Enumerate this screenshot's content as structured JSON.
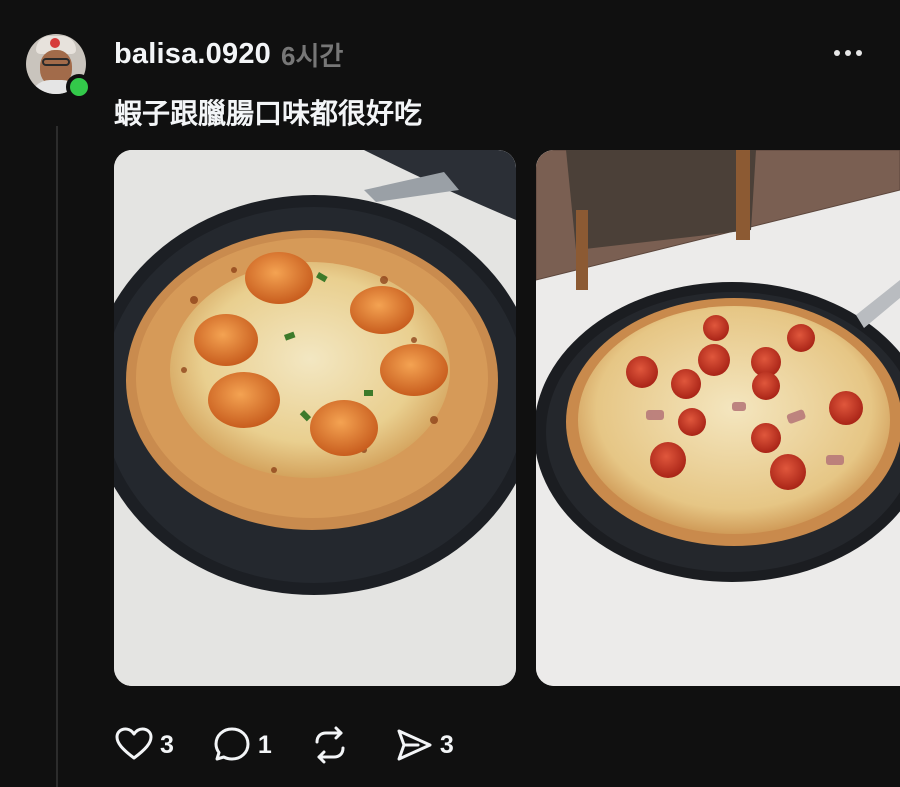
{
  "post": {
    "username": "balisa.0920",
    "timestamp": "6시간",
    "caption": "蝦子跟臘腸口味都很好吃",
    "online_status_color": "#33c94a",
    "images": [
      {
        "name": "photo-shrimp-pizza"
      },
      {
        "name": "photo-pepperoni-pizza"
      }
    ]
  },
  "actions": {
    "like": {
      "icon": "heart-icon",
      "count": "3"
    },
    "comment": {
      "icon": "comment-bubble-icon",
      "count": "1"
    },
    "repost": {
      "icon": "repost-icon",
      "count": ""
    },
    "share": {
      "icon": "send-icon",
      "count": "3"
    }
  },
  "menu": {
    "icon": "more-dots-icon"
  }
}
